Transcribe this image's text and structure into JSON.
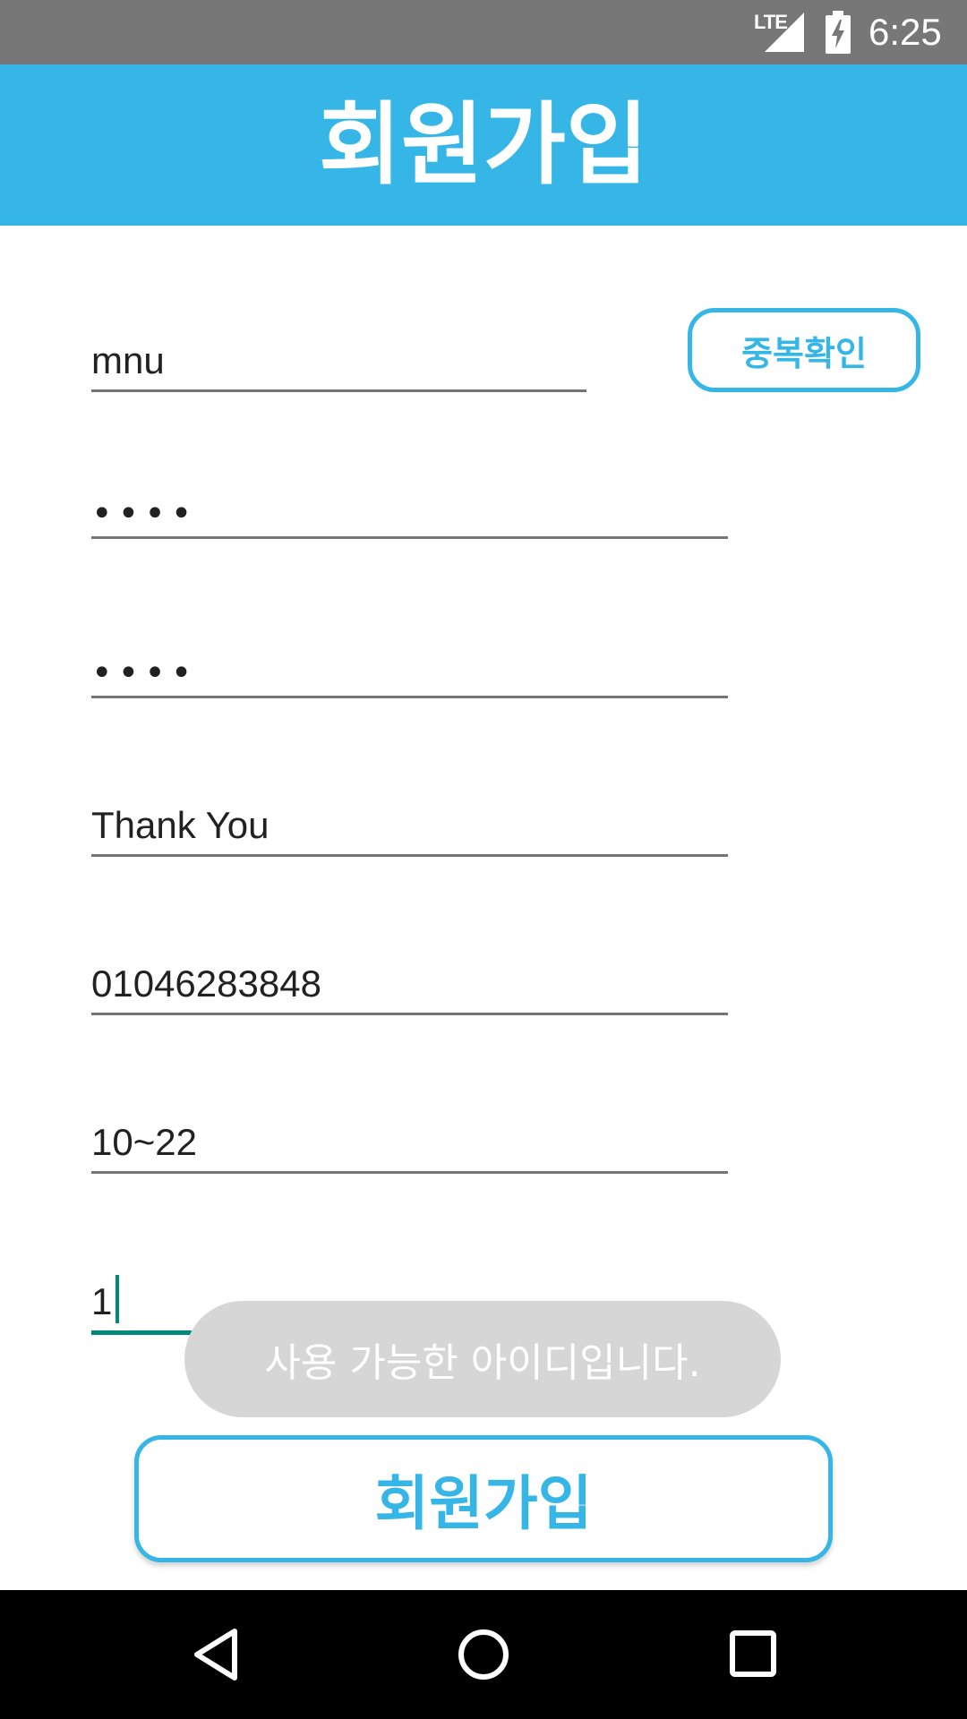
{
  "status_bar": {
    "network_label": "LTE",
    "time": "6:25",
    "icons": [
      "signal-icon",
      "battery-charging-icon"
    ]
  },
  "app_bar": {
    "title": "회원가입"
  },
  "form": {
    "id_value": "mnu",
    "password_mask": "••••",
    "password_confirm_mask": "••••",
    "name_value": "Thank You",
    "phone_value": "01046283848",
    "age_value": "10~22",
    "last_value": "1",
    "duplicate_check_label": "중복확인"
  },
  "toast": {
    "message": "사용 가능한 아이디입니다."
  },
  "register_button_label": "회원가입",
  "nav_bar": {
    "icons": [
      "back-icon",
      "home-icon",
      "recents-icon"
    ]
  },
  "colors": {
    "accent": "#36b6e6",
    "status_bar": "#777777",
    "focus_underline": "#00897b",
    "toast_bg": "#d6d6d6"
  }
}
